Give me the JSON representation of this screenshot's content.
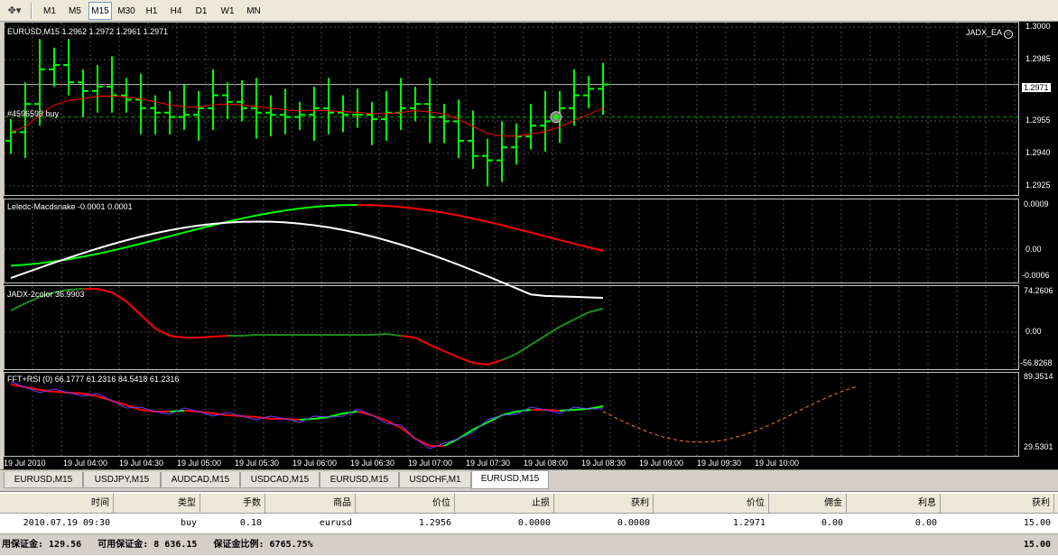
{
  "toolbar": {
    "tool_icon": "cursor-tools-icon",
    "timeframes": [
      "M1",
      "M5",
      "M15",
      "M30",
      "H1",
      "H4",
      "D1",
      "W1",
      "MN"
    ],
    "active_timeframe": "M15"
  },
  "chart": {
    "header": "EURUSD,M15  1.2962 1.2972 1.2961 1.2971",
    "ea_label": "JADX_EA",
    "order_label": "#4596593 buy",
    "current_price": "1.2971",
    "price_axis": [
      "1.3000",
      "1.2985",
      "1.2955",
      "1.2940",
      "1.2925"
    ],
    "pane_labels": {
      "macd": "Leledc-Macdsnake -0.0001 0.0001",
      "jadx": "JADX-2color 36.9903",
      "fft": "FFT+RSI (0) 66.1777 61.2316 84.5418 61.2316"
    },
    "macd_axis": [
      "0.0009",
      "0.00",
      "-0.0006"
    ],
    "jadx_axis": [
      "74.2606",
      "0.00",
      "-56.8268"
    ],
    "fft_axis": [
      "89.3514",
      "29.5301"
    ],
    "time_axis": [
      "19 Jul 2010",
      "19 Jul 04:00",
      "19 Jul 04:30",
      "19 Jul 05:00",
      "19 Jul 05:30",
      "19 Jul 06:00",
      "19 Jul 06:30",
      "19 Jul 07:00",
      "19 Jul 07:30",
      "19 Jul 08:00",
      "19 Jul 08:30",
      "19 Jul 09:00",
      "19 Jul 09:30",
      "19 Jul 10:00"
    ],
    "colors": {
      "bull": "#00ff00",
      "ma": "#ff0000",
      "macd_line": "#ffffff",
      "grid": "#4a4a4a",
      "dark_green": "#1e8c1e",
      "fft_blue": "#6a3cff",
      "fft_orange": "#ff8000"
    }
  },
  "chart_data": [
    {
      "type": "line",
      "title": "EURUSD,M15",
      "ylim": [
        1.292,
        1.3
      ],
      "series": [
        {
          "name": "EURUSD,M15",
          "values": [
            1.2949,
            1.2962,
            1.2978,
            1.298,
            1.2972,
            1.2968,
            1.297,
            1.2966,
            1.2964,
            1.296,
            1.2958,
            1.2956,
            1.2957,
            1.296,
            1.2966,
            1.2963,
            1.296,
            1.2958,
            1.2957,
            1.2956,
            1.2957,
            1.296,
            1.2958,
            1.2957,
            1.2957,
            1.2955,
            1.2958,
            1.296,
            1.2962,
            1.2956,
            1.2954,
            1.2945,
            1.2938,
            1.2936,
            1.2942,
            1.2947,
            1.2952,
            1.2954,
            1.296,
            1.2966,
            1.2969,
            1.2971
          ]
        }
      ]
    }
  ],
  "tabs": [
    "EURUSD,M15",
    "USDJPY,M15",
    "AUDCAD,M15",
    "USDCAD,M15",
    "EURUSD,M15",
    "USDCHF,M1",
    "EURUSD,M15"
  ],
  "active_tab_index": 6,
  "terminal": {
    "headers": [
      "时间",
      "类型",
      "手数",
      "商品",
      "价位",
      "止损",
      "获利",
      "价位",
      "佣金",
      "利息",
      "获利"
    ],
    "row": [
      "2010.07.19 09:30",
      "buy",
      "0.10",
      "eurusd",
      "1.2956",
      "0.0000",
      "0.0000",
      "1.2971",
      "0.00",
      "0.00",
      "15.00"
    ],
    "summary": "用保证金: 129.56   可用保证金: 8 636.15   保证金比例: 6765.75%",
    "summary_profit": "15.00"
  }
}
